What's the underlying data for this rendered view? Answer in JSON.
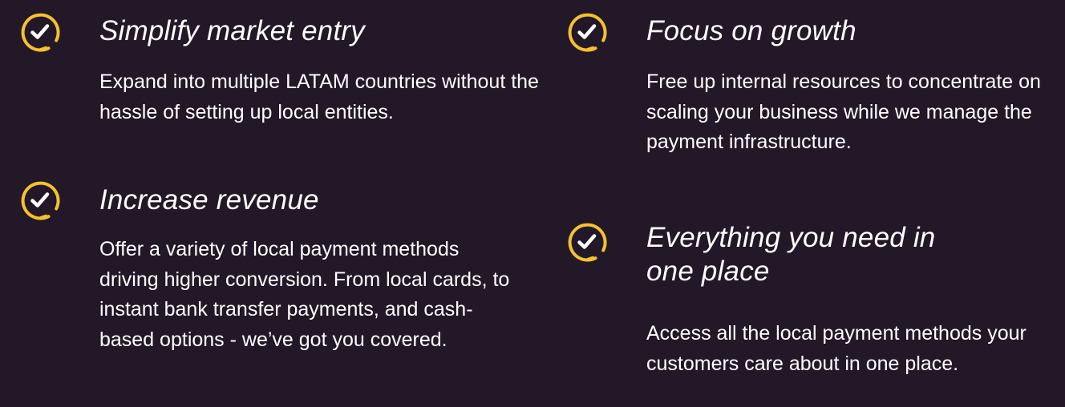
{
  "colors": {
    "background": "#231828",
    "accent": "#F5C12E",
    "text": "#FFFFFF"
  },
  "features": [
    {
      "icon": "check-circle-icon",
      "title": "Simplify market entry",
      "description": "Expand into multiple LATAM countries without the hassle of setting up local entities."
    },
    {
      "icon": "check-circle-icon",
      "title": "Increase revenue",
      "description": "Offer a variety of local payment methods driving higher conversion. From local cards, to instant bank transfer payments, and cash-based options  - we’ve got you covered."
    },
    {
      "icon": "check-circle-icon",
      "title": "Focus on growth",
      "description": "Free up internal resources to concentrate on scaling your business while we manage the payment infrastructure."
    },
    {
      "icon": "check-circle-icon",
      "title": "Everything you need in one place",
      "description": "Access all the local payment methods your customers care about in one place."
    }
  ]
}
